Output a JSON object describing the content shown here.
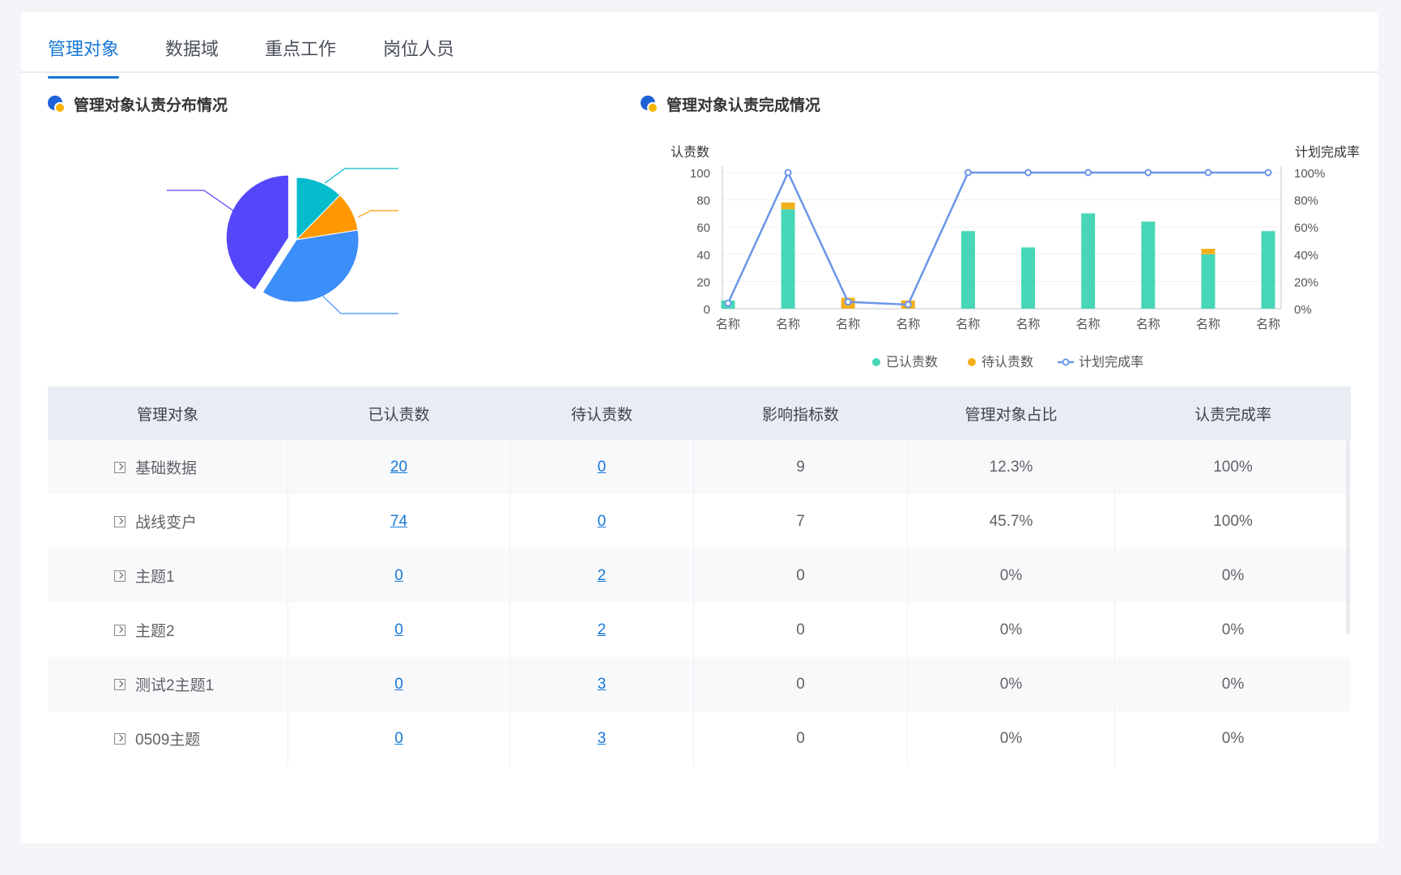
{
  "tabs": [
    {
      "label": "管理对象",
      "active": true
    },
    {
      "label": "数据域",
      "active": false
    },
    {
      "label": "重点工作",
      "active": false
    },
    {
      "label": "岗位人员",
      "active": false
    }
  ],
  "left_section": {
    "title": "管理对象认责分布情况",
    "icon": "chart-badge-icon"
  },
  "right_section": {
    "title": "管理对象认责完成情况",
    "icon": "chart-badge-icon"
  },
  "colors": {
    "accent": "#1677d6",
    "claimed": "#47d7b8",
    "pending": "#f3b01e",
    "rate": "#6a96e8",
    "pie": [
      "#04bccc",
      "#ff9800",
      "#3c8ef8",
      "#5446f9"
    ]
  },
  "chart_data": [
    {
      "type": "pie",
      "title": "管理对象认责分布情况",
      "slices": [
        {
          "value": 12.3,
          "color": "#04bccc"
        },
        {
          "value": 10.2,
          "color": "#ff9800"
        },
        {
          "value": 36.6,
          "color": "#3c8ef8"
        },
        {
          "value": 40.9,
          "color": "#5446f9"
        }
      ]
    },
    {
      "type": "bar",
      "title": "管理对象认责完成情况",
      "ylabel": "认责数",
      "y2label": "计划完成率",
      "ylim": [
        0,
        100
      ],
      "y2lim": [
        0,
        100
      ],
      "yticks": [
        "0",
        "20",
        "40",
        "60",
        "80",
        "100"
      ],
      "y2ticks": [
        "0%",
        "20%",
        "40%",
        "60%",
        "80%",
        "100%"
      ],
      "categories": [
        "名称",
        "名称",
        "名称",
        "名称",
        "名称",
        "名称",
        "名称",
        "名称",
        "名称",
        "名称"
      ],
      "series": [
        {
          "name": "已认责数",
          "kind": "bar",
          "values": [
            6,
            73,
            0,
            0,
            57,
            45,
            70,
            64,
            40,
            57
          ]
        },
        {
          "name": "待认责数",
          "kind": "bar",
          "values": [
            0,
            5,
            8,
            6,
            0,
            0,
            0,
            0,
            4,
            0
          ]
        },
        {
          "name": "计划完成率",
          "kind": "line",
          "axis": "right",
          "values": [
            4,
            100,
            5,
            3,
            100,
            100,
            100,
            100,
            100,
            100
          ]
        }
      ],
      "legend": "bottom"
    }
  ],
  "table": {
    "headers": [
      "管理对象",
      "已认责数",
      "待认责数",
      "影响指标数",
      "管理对象占比",
      "认责完成率"
    ],
    "rows": [
      {
        "name": "基础数据",
        "claimed": "20",
        "pending": "0",
        "indicators": "9",
        "ratio": "12.3%",
        "rate": "100%"
      },
      {
        "name": "战线变户",
        "claimed": "74",
        "pending": "0",
        "indicators": "7",
        "ratio": "45.7%",
        "rate": "100%"
      },
      {
        "name": "主题1",
        "claimed": "0",
        "pending": "2",
        "indicators": "0",
        "ratio": "0%",
        "rate": "0%"
      },
      {
        "name": "主题2",
        "claimed": "0",
        "pending": "2",
        "indicators": "0",
        "ratio": "0%",
        "rate": "0%"
      },
      {
        "name": "测试2主题1",
        "claimed": "0",
        "pending": "3",
        "indicators": "0",
        "ratio": "0%",
        "rate": "0%"
      },
      {
        "name": "0509主题",
        "claimed": "0",
        "pending": "3",
        "indicators": "0",
        "ratio": "0%",
        "rate": "0%"
      }
    ]
  }
}
